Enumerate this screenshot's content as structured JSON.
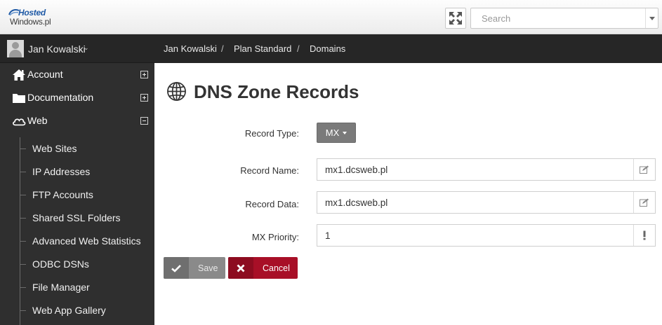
{
  "brand": {
    "line1": "Hosted",
    "line2": "Windows.pl"
  },
  "search": {
    "placeholder": "Search",
    "value": ""
  },
  "user": {
    "name": "Jan Kowalski"
  },
  "breadcrumb": [
    "Jan Kowalski",
    "Plan Standard",
    "Domains"
  ],
  "breadcrumb_separator": "/",
  "sidebar": {
    "menu": [
      {
        "label": "Account",
        "icon": "home-icon",
        "expanded": false
      },
      {
        "label": "Documentation",
        "icon": "folder-icon",
        "expanded": false
      },
      {
        "label": "Web",
        "icon": "cloud-icon",
        "expanded": true
      }
    ],
    "web_items": [
      "Web Sites",
      "IP Addresses",
      "FTP Accounts",
      "Shared SSL Folders",
      "Advanced Web Statistics",
      "ODBC DSNs",
      "File Manager",
      "Web App Gallery"
    ]
  },
  "page": {
    "title": "DNS Zone Records",
    "icon": "globe-icon"
  },
  "form": {
    "record_type_label": "Record Type:",
    "record_type_value": "MX",
    "record_name_label": "Record Name:",
    "record_name_value": "mx1.dcsweb.pl",
    "record_data_label": "Record Data:",
    "record_data_value": "mx1.dcsweb.pl",
    "mx_priority_label": "MX Priority:",
    "mx_priority_value": "1"
  },
  "buttons": {
    "save": "Save",
    "cancel": "Cancel"
  },
  "colors": {
    "sidebar_bg": "#2f2f2f",
    "header_bg": "#262626",
    "cancel": "#a80f27",
    "save": "#8a8a8a"
  }
}
